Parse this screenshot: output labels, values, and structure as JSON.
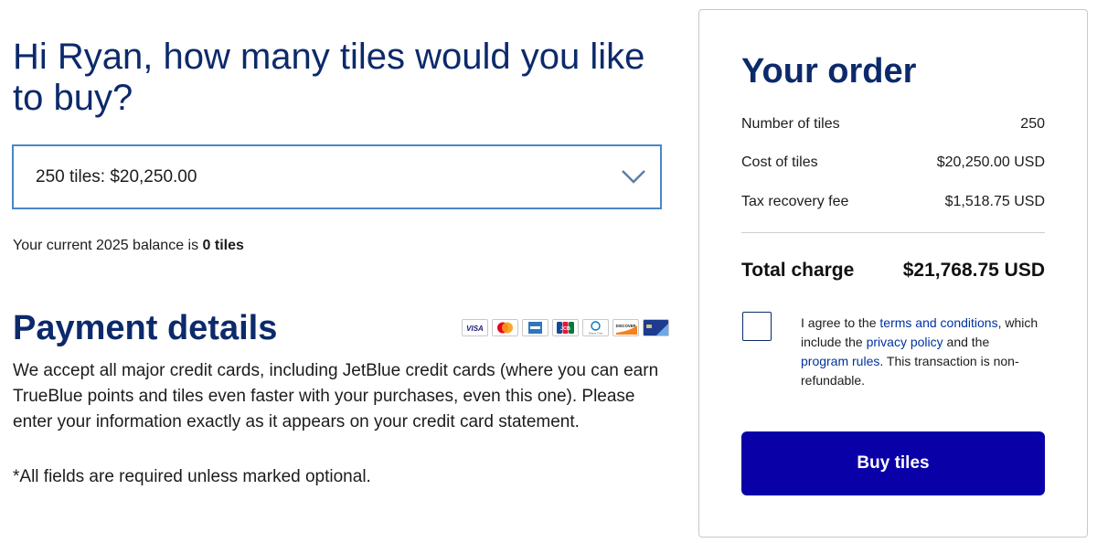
{
  "purchase": {
    "heading": "Hi Ryan, how many tiles would you like to buy?",
    "select_value": "250 tiles: $20,250.00",
    "balance_prefix": "Your current 2025 balance is ",
    "balance_value": "0 tiles"
  },
  "payment": {
    "title": "Payment details",
    "description": "We accept all major credit cards, including JetBlue credit cards (where you can earn TrueBlue points and tiles even faster with your purchases, even this one). Please enter your information exactly as it appears on your credit card statement.",
    "required_note": "*All fields are required unless marked optional.",
    "card_logos": [
      {
        "name": "visa",
        "label": "VISA"
      },
      {
        "name": "mastercard",
        "label": ""
      },
      {
        "name": "amex",
        "label": ""
      },
      {
        "name": "jcb",
        "label": "JCB"
      },
      {
        "name": "diners-club",
        "label": "Diners Club"
      },
      {
        "name": "discover",
        "label": "DISCOVER"
      },
      {
        "name": "jetblue-card",
        "label": ""
      }
    ]
  },
  "order": {
    "title": "Your order",
    "rows": [
      {
        "label": "Number of tiles",
        "value": "250"
      },
      {
        "label": "Cost of tiles",
        "value": "$20,250.00 USD"
      },
      {
        "label": "Tax recovery fee",
        "value": "$1,518.75 USD"
      }
    ],
    "total_label": "Total charge",
    "total_value": "$21,768.75 USD",
    "agree_part1": "I agree to the ",
    "terms_link": "terms and conditions",
    "agree_part2": ", which include the ",
    "privacy_link": "privacy policy",
    "agree_part3": " and the ",
    "program_link": "program rules",
    "agree_part4": ". This transaction is non-refundable.",
    "buy_label": "Buy tiles"
  },
  "colors": {
    "heading": "#0c2a6b",
    "link": "#0033a0",
    "button": "#0a00a7",
    "select_border": "#4a86c8"
  }
}
